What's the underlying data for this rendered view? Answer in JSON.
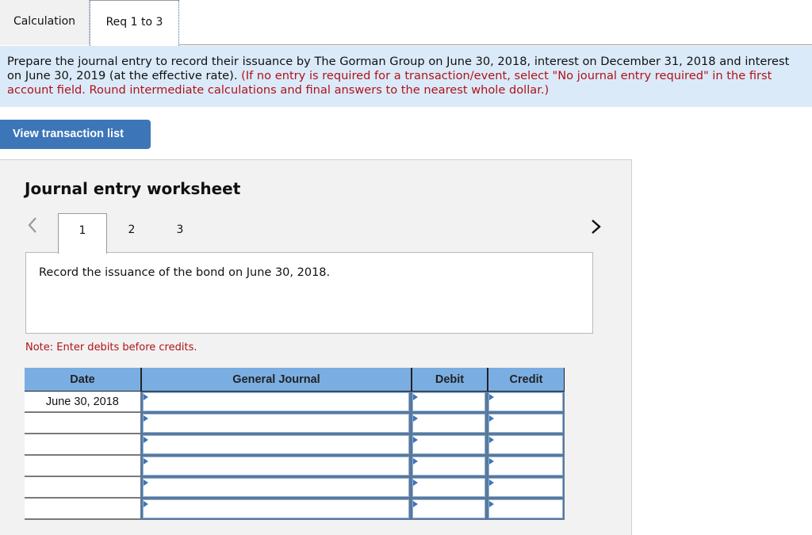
{
  "tabs": [
    {
      "label": "Calculation",
      "active": false
    },
    {
      "label": "Req 1 to 3",
      "active": true
    }
  ],
  "instructions": {
    "main_text": "Prepare the journal entry to record their issuance by The Gorman Group on June 30, 2018, interest on December 31, 2018 and interest on June 30, 2019 (at the effective rate).",
    "note_text": "(If no entry is required for a transaction/event, select \"No journal entry required\" in the first account field. Round intermediate calculations and final answers to the nearest whole dollar.)"
  },
  "view_transaction_button": "View transaction list",
  "worksheet": {
    "title": "Journal entry worksheet",
    "steps": [
      "1",
      "2",
      "3"
    ],
    "active_step": "1",
    "description": "Record the issuance of the bond on June 30, 2018.",
    "note": "Note: Enter debits before credits.",
    "table": {
      "headers": [
        "Date",
        "General Journal",
        "Debit",
        "Credit"
      ],
      "rows": [
        {
          "date": "June 30, 2018",
          "account": "",
          "debit": "",
          "credit": ""
        },
        {
          "date": "",
          "account": "",
          "debit": "",
          "credit": ""
        },
        {
          "date": "",
          "account": "",
          "debit": "",
          "credit": ""
        },
        {
          "date": "",
          "account": "",
          "debit": "",
          "credit": ""
        },
        {
          "date": "",
          "account": "",
          "debit": "",
          "credit": ""
        },
        {
          "date": "",
          "account": "",
          "debit": "",
          "credit": ""
        }
      ]
    }
  },
  "colors": {
    "accent_blue": "#3d76b8",
    "header_blue": "#7aaee2",
    "instruction_bg": "#dbeaf8",
    "note_red": "#b0121b"
  }
}
